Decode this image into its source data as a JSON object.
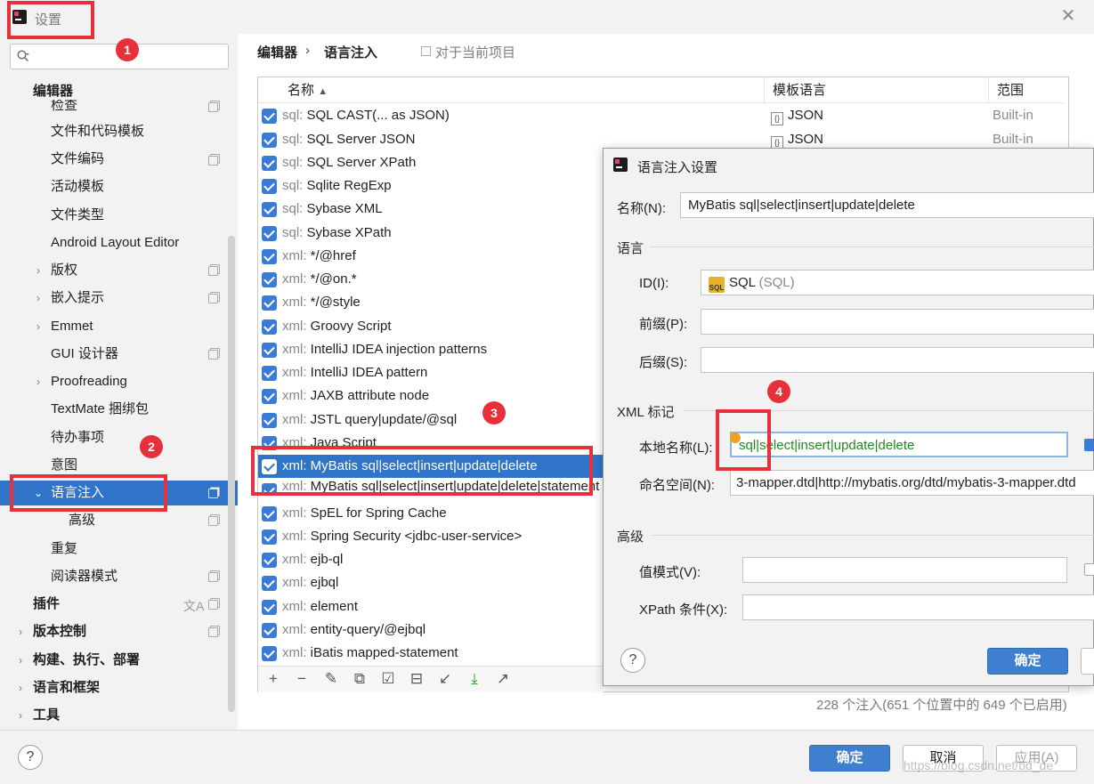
{
  "window": {
    "title": "设置"
  },
  "search": {
    "placeholder": ""
  },
  "sidebar": {
    "items": [
      {
        "label": "编辑器"
      },
      {
        "label": "检查"
      },
      {
        "label": "文件和代码模板"
      },
      {
        "label": "文件编码"
      },
      {
        "label": "活动模板"
      },
      {
        "label": "文件类型"
      },
      {
        "label": "Android Layout Editor"
      },
      {
        "label": "版权"
      },
      {
        "label": "嵌入提示"
      },
      {
        "label": "Emmet"
      },
      {
        "label": "GUI 设计器"
      },
      {
        "label": "Proofreading"
      },
      {
        "label": "TextMate 捆绑包"
      },
      {
        "label": "待办事项"
      },
      {
        "label": "意图"
      },
      {
        "label": "语言注入"
      },
      {
        "label": "高级"
      },
      {
        "label": "重复"
      },
      {
        "label": "阅读器模式"
      },
      {
        "label": "插件"
      },
      {
        "label": "版本控制"
      },
      {
        "label": "构建、执行、部署"
      },
      {
        "label": "语言和框架"
      },
      {
        "label": "工具"
      }
    ],
    "translate_icon": "文A"
  },
  "breadcrumb": {
    "parent": "编辑器",
    "sep": "›",
    "current": "语言注入",
    "project_note": "对于当前项目"
  },
  "table": {
    "columns": {
      "name": "名称",
      "sort_arrow": "▲",
      "template": "模板语言",
      "scope": "范围"
    },
    "rows": [
      {
        "pre": "sql:",
        "name": " SQL CAST(... as JSON)",
        "tmpl": "JSON",
        "scope": "Built-in"
      },
      {
        "pre": "sql:",
        "name": " SQL Server JSON",
        "tmpl": "JSON",
        "scope": "Built-in"
      },
      {
        "pre": "sql:",
        "name": " SQL Server XPath"
      },
      {
        "pre": "sql:",
        "name": " Sqlite RegExp"
      },
      {
        "pre": "sql:",
        "name": " Sybase XML"
      },
      {
        "pre": "sql:",
        "name": " Sybase XPath"
      },
      {
        "pre": "xml:",
        "name": " */@href"
      },
      {
        "pre": "xml:",
        "name": " */@on.*"
      },
      {
        "pre": "xml:",
        "name": " */@style"
      },
      {
        "pre": "xml:",
        "name": " Groovy Script"
      },
      {
        "pre": "xml:",
        "name": " IntelliJ IDEA injection patterns"
      },
      {
        "pre": "xml:",
        "name": " IntelliJ IDEA pattern"
      },
      {
        "pre": "xml:",
        "name": " JAXB attribute node"
      },
      {
        "pre": "xml:",
        "name": " JSTL query|update/@sql"
      },
      {
        "pre": "xml:",
        "name": " Java Script"
      },
      {
        "pre": "xml:",
        "name": " MyBatis sql|select|insert|update|delete"
      },
      {
        "pre": "xml:",
        "name": " MyBatis sql|select|insert|update|delete|statement"
      },
      {
        "pre": "xml:",
        "name": " SpEL for Spring Cache"
      },
      {
        "pre": "xml:",
        "name": " Spring Security <jdbc-user-service>"
      },
      {
        "pre": "xml:",
        "name": " ejb-ql"
      },
      {
        "pre": "xml:",
        "name": " ejbql"
      },
      {
        "pre": "xml:",
        "name": " element"
      },
      {
        "pre": "xml:",
        "name": " entity-query/@ejbql"
      },
      {
        "pre": "xml:",
        "name": " iBatis mapped-statement"
      }
    ],
    "json_icon": "{}"
  },
  "toolbar": {
    "add": "+",
    "remove": "−",
    "edit": "✎",
    "copy": "⧉",
    "check": "☑",
    "uncheck": "⊟",
    "move": "↙",
    "import": "⤓",
    "export": "↗"
  },
  "status": {
    "count": "228 个注入(651 个位置中的 649 个已启用)"
  },
  "footer": {
    "help": "?",
    "ok": "确定",
    "cancel": "取消",
    "apply": "应用(A)"
  },
  "dialog": {
    "title": "语言注入设置",
    "name_label": "名称(N):",
    "name_value": "MyBatis sql|select|insert|update|delete",
    "lang_section": "语言",
    "id_label": "ID(I):",
    "id_icon": "SQL",
    "id_value": "SQL",
    "id_hint": " (SQL)",
    "prefix_label": "前缀(P):",
    "suffix_label": "后缀(S):",
    "xml_section": "XML 标记",
    "local_label": "本地名称(L):",
    "local_value": "sql|select|insert|update|delete",
    "ns_label": "命名空间(N):",
    "ns_value": "3-mapper.dtd|http://mybatis.org/dtd/mybatis-3-mapper.dtd",
    "adv_section": "高级",
    "value_label": "值模式(V):",
    "xpath_label": "XPath 条件(X):",
    "help": "?",
    "ok": "确定"
  },
  "badges": {
    "b1": "1",
    "b2": "2",
    "b3": "3",
    "b4": "4"
  },
  "watermark": "https://blog.csdn.net/bd_de",
  "colors": {
    "accent": "#2f74c8",
    "annotation": "#e8303a"
  }
}
